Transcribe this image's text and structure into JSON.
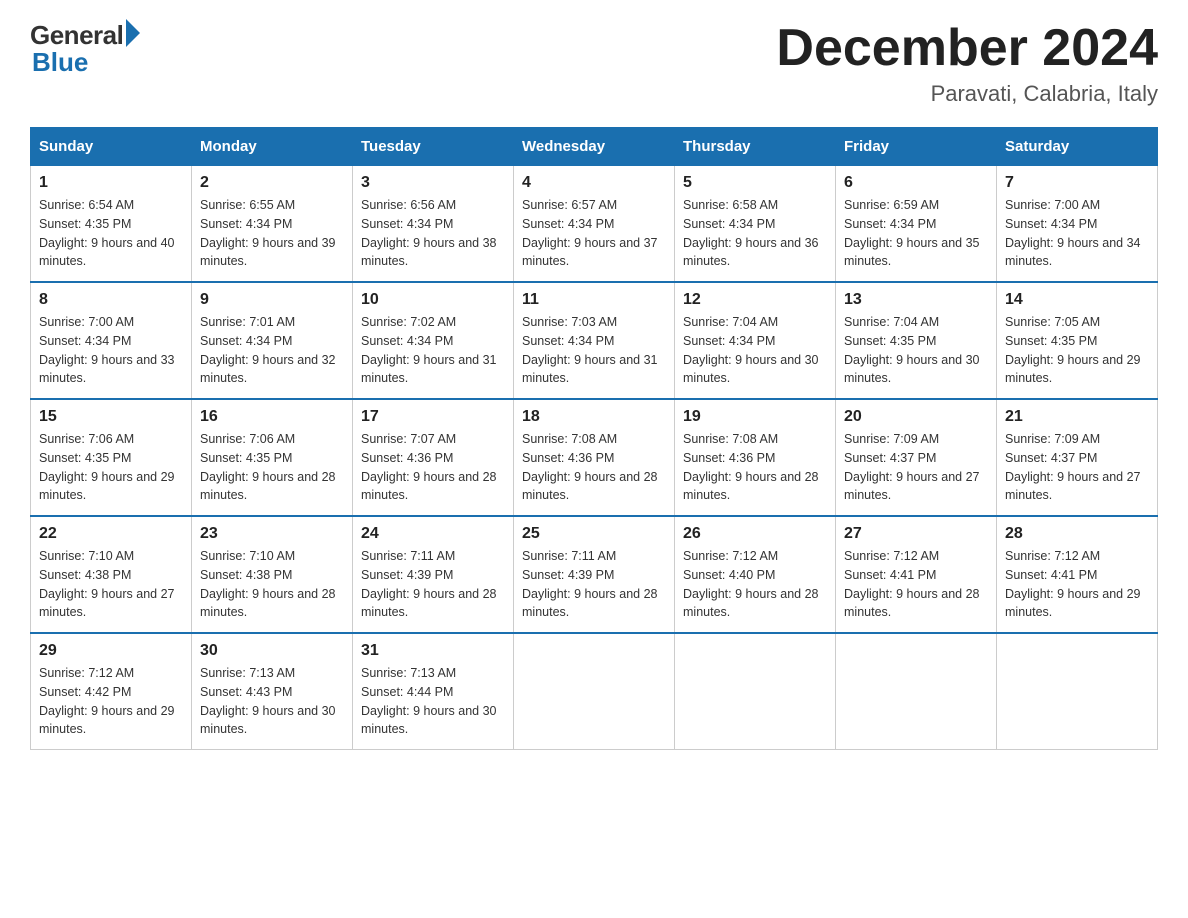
{
  "header": {
    "logo_general": "General",
    "logo_blue": "Blue",
    "month_title": "December 2024",
    "location": "Paravati, Calabria, Italy"
  },
  "days_of_week": [
    "Sunday",
    "Monday",
    "Tuesday",
    "Wednesday",
    "Thursday",
    "Friday",
    "Saturday"
  ],
  "weeks": [
    [
      {
        "day": "1",
        "sunrise": "6:54 AM",
        "sunset": "4:35 PM",
        "daylight": "9 hours and 40 minutes."
      },
      {
        "day": "2",
        "sunrise": "6:55 AM",
        "sunset": "4:34 PM",
        "daylight": "9 hours and 39 minutes."
      },
      {
        "day": "3",
        "sunrise": "6:56 AM",
        "sunset": "4:34 PM",
        "daylight": "9 hours and 38 minutes."
      },
      {
        "day": "4",
        "sunrise": "6:57 AM",
        "sunset": "4:34 PM",
        "daylight": "9 hours and 37 minutes."
      },
      {
        "day": "5",
        "sunrise": "6:58 AM",
        "sunset": "4:34 PM",
        "daylight": "9 hours and 36 minutes."
      },
      {
        "day": "6",
        "sunrise": "6:59 AM",
        "sunset": "4:34 PM",
        "daylight": "9 hours and 35 minutes."
      },
      {
        "day": "7",
        "sunrise": "7:00 AM",
        "sunset": "4:34 PM",
        "daylight": "9 hours and 34 minutes."
      }
    ],
    [
      {
        "day": "8",
        "sunrise": "7:00 AM",
        "sunset": "4:34 PM",
        "daylight": "9 hours and 33 minutes."
      },
      {
        "day": "9",
        "sunrise": "7:01 AM",
        "sunset": "4:34 PM",
        "daylight": "9 hours and 32 minutes."
      },
      {
        "day": "10",
        "sunrise": "7:02 AM",
        "sunset": "4:34 PM",
        "daylight": "9 hours and 31 minutes."
      },
      {
        "day": "11",
        "sunrise": "7:03 AM",
        "sunset": "4:34 PM",
        "daylight": "9 hours and 31 minutes."
      },
      {
        "day": "12",
        "sunrise": "7:04 AM",
        "sunset": "4:34 PM",
        "daylight": "9 hours and 30 minutes."
      },
      {
        "day": "13",
        "sunrise": "7:04 AM",
        "sunset": "4:35 PM",
        "daylight": "9 hours and 30 minutes."
      },
      {
        "day": "14",
        "sunrise": "7:05 AM",
        "sunset": "4:35 PM",
        "daylight": "9 hours and 29 minutes."
      }
    ],
    [
      {
        "day": "15",
        "sunrise": "7:06 AM",
        "sunset": "4:35 PM",
        "daylight": "9 hours and 29 minutes."
      },
      {
        "day": "16",
        "sunrise": "7:06 AM",
        "sunset": "4:35 PM",
        "daylight": "9 hours and 28 minutes."
      },
      {
        "day": "17",
        "sunrise": "7:07 AM",
        "sunset": "4:36 PM",
        "daylight": "9 hours and 28 minutes."
      },
      {
        "day": "18",
        "sunrise": "7:08 AM",
        "sunset": "4:36 PM",
        "daylight": "9 hours and 28 minutes."
      },
      {
        "day": "19",
        "sunrise": "7:08 AM",
        "sunset": "4:36 PM",
        "daylight": "9 hours and 28 minutes."
      },
      {
        "day": "20",
        "sunrise": "7:09 AM",
        "sunset": "4:37 PM",
        "daylight": "9 hours and 27 minutes."
      },
      {
        "day": "21",
        "sunrise": "7:09 AM",
        "sunset": "4:37 PM",
        "daylight": "9 hours and 27 minutes."
      }
    ],
    [
      {
        "day": "22",
        "sunrise": "7:10 AM",
        "sunset": "4:38 PM",
        "daylight": "9 hours and 27 minutes."
      },
      {
        "day": "23",
        "sunrise": "7:10 AM",
        "sunset": "4:38 PM",
        "daylight": "9 hours and 28 minutes."
      },
      {
        "day": "24",
        "sunrise": "7:11 AM",
        "sunset": "4:39 PM",
        "daylight": "9 hours and 28 minutes."
      },
      {
        "day": "25",
        "sunrise": "7:11 AM",
        "sunset": "4:39 PM",
        "daylight": "9 hours and 28 minutes."
      },
      {
        "day": "26",
        "sunrise": "7:12 AM",
        "sunset": "4:40 PM",
        "daylight": "9 hours and 28 minutes."
      },
      {
        "day": "27",
        "sunrise": "7:12 AM",
        "sunset": "4:41 PM",
        "daylight": "9 hours and 28 minutes."
      },
      {
        "day": "28",
        "sunrise": "7:12 AM",
        "sunset": "4:41 PM",
        "daylight": "9 hours and 29 minutes."
      }
    ],
    [
      {
        "day": "29",
        "sunrise": "7:12 AM",
        "sunset": "4:42 PM",
        "daylight": "9 hours and 29 minutes."
      },
      {
        "day": "30",
        "sunrise": "7:13 AM",
        "sunset": "4:43 PM",
        "daylight": "9 hours and 30 minutes."
      },
      {
        "day": "31",
        "sunrise": "7:13 AM",
        "sunset": "4:44 PM",
        "daylight": "9 hours and 30 minutes."
      },
      null,
      null,
      null,
      null
    ]
  ],
  "labels": {
    "sunrise_prefix": "Sunrise: ",
    "sunset_prefix": "Sunset: ",
    "daylight_prefix": "Daylight: "
  }
}
